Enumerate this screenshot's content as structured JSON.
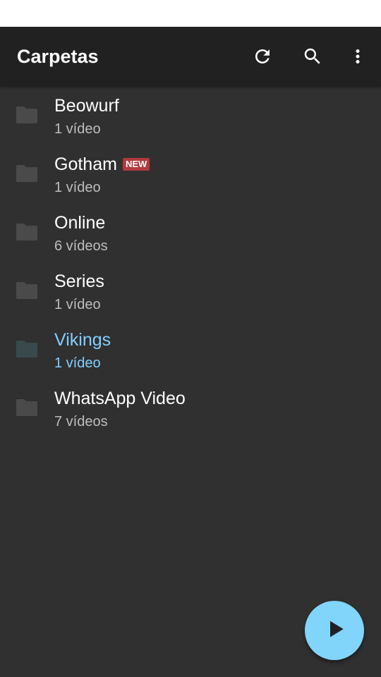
{
  "app_bar": {
    "title": "Carpetas",
    "actions": [
      {
        "name": "refresh",
        "icon": "refresh-icon"
      },
      {
        "name": "search",
        "icon": "search-icon"
      },
      {
        "name": "more",
        "icon": "more-vert-icon"
      }
    ]
  },
  "folders": [
    {
      "name": "Beowurf",
      "count": "1 vídeo",
      "badge": "",
      "active": false
    },
    {
      "name": "Gotham",
      "count": "1 vídeo",
      "badge": "NEW",
      "active": false
    },
    {
      "name": "Online",
      "count": "6 vídeos",
      "badge": "",
      "active": false
    },
    {
      "name": "Series",
      "count": "1 vídeo",
      "badge": "",
      "active": false
    },
    {
      "name": "Vikings",
      "count": "1 vídeo",
      "badge": "",
      "active": true
    },
    {
      "name": "WhatsApp Video",
      "count": "7 vídeos",
      "badge": "",
      "active": false
    }
  ],
  "fab": {
    "icon": "play-icon"
  },
  "colors": {
    "app_bar_bg": "#212121",
    "content_bg": "#303030",
    "active_text": "#81cfff",
    "badge_bg": "#b3393d",
    "fab_bg": "#81d4fa"
  }
}
